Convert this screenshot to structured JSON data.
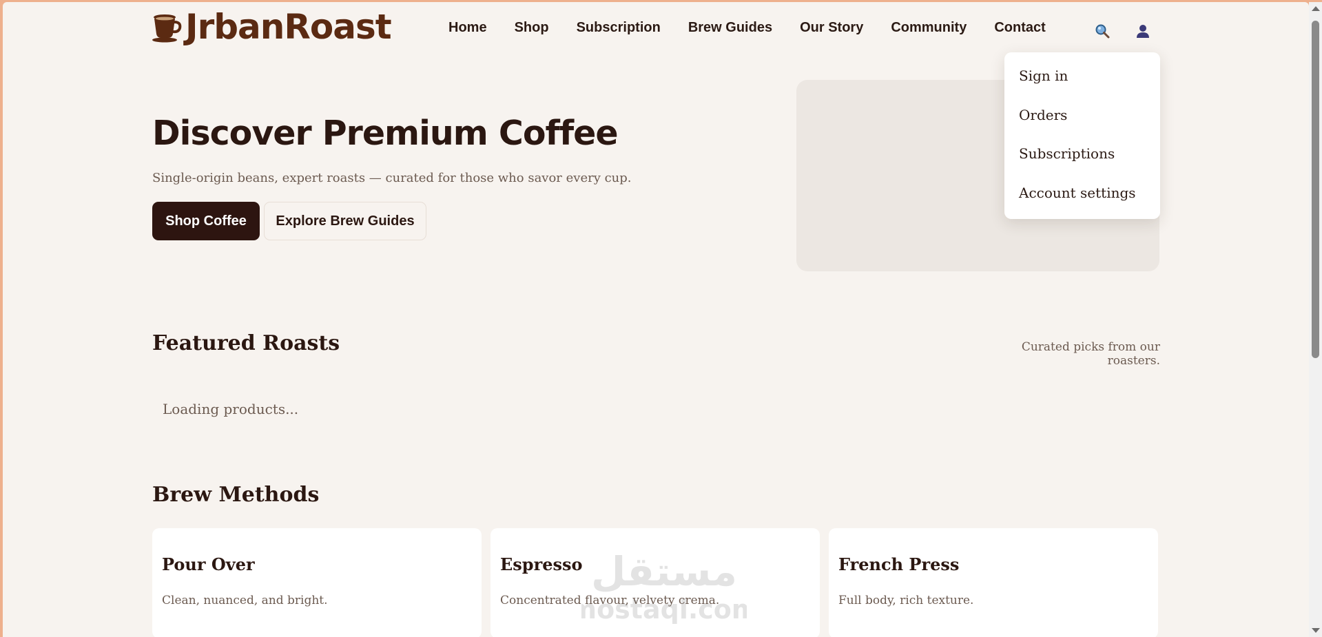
{
  "brand": {
    "name": "JrbanRoast",
    "logo_icon": "coffee-cup-icon",
    "color": "#5b2a12"
  },
  "nav": {
    "items": [
      "Home",
      "Shop",
      "Subscription",
      "Brew Guides",
      "Our Story",
      "Community",
      "Contact"
    ],
    "icons": [
      "search-icon",
      "user-icon"
    ]
  },
  "account_menu": {
    "items": [
      "Sign in",
      "Orders",
      "Subscriptions",
      "Account settings"
    ]
  },
  "hero": {
    "title": "Discover Premium Coffee",
    "subtitle": "Single-origin beans, expert roasts — curated for those who savor every cup.",
    "primary_cta": "Shop Coffee",
    "secondary_cta": "Explore Brew Guides"
  },
  "featured": {
    "title": "Featured Roasts",
    "note": "Curated picks from our roasters.",
    "status": "Loading products..."
  },
  "brew": {
    "title": "Brew Methods",
    "cards": [
      {
        "title": "Pour Over",
        "desc": "Clean, nuanced, and bright."
      },
      {
        "title": "Espresso",
        "desc": "Concentrated flavour, velvety crema."
      },
      {
        "title": "French Press",
        "desc": "Full body, rich texture."
      }
    ]
  },
  "watermark": {
    "text_ar": "مستقل",
    "text": "mostaql.com"
  },
  "colors": {
    "page_bg": "#f7f3ef",
    "frame": "#eeb08d",
    "primary_button": "#2d1510",
    "text_dark": "#2b1711",
    "text_muted": "#6b5a50"
  }
}
